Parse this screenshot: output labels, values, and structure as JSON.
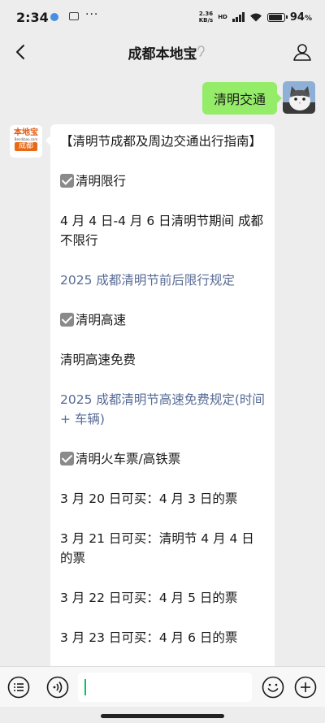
{
  "status": {
    "time": "2:34",
    "net_speed": "2.36\nKB/s",
    "hd": "HD",
    "battery": "94",
    "battery_unit": "%",
    "battery_level": 0.94
  },
  "header": {
    "title": "成都本地宝"
  },
  "chat": {
    "sent": {
      "text": "清明交通"
    },
    "sender_avatar": {
      "logo_top": "本地宝",
      "logo_url": "Bendibao.com",
      "logo_city": "成都"
    },
    "reply": [
      {
        "kind": "text",
        "text": "【清明节成都及周边交通出行指南】"
      },
      {
        "kind": "check",
        "text": "清明限行"
      },
      {
        "kind": "text",
        "text": "4 月 4 日-4 月 6 日清明节期间 成都不限行"
      },
      {
        "kind": "link",
        "text": "2025 成都清明节前后限行规定"
      },
      {
        "kind": "check",
        "text": "清明高速"
      },
      {
        "kind": "text",
        "text": "清明高速免费"
      },
      {
        "kind": "link",
        "text": "2025 成都清明节高速免费规定(时间 + 车辆)"
      },
      {
        "kind": "check",
        "text": "清明火车票/高铁票"
      },
      {
        "kind": "text",
        "text": "3 月 20 日可买：4 月 3 日的票"
      },
      {
        "kind": "text",
        "text": "3 月 21 日可买：清明节 4 月 4 日的票"
      },
      {
        "kind": "text",
        "text": "3 月 22 日可买：4 月 5 日的票"
      },
      {
        "kind": "text",
        "text": "3 月 23 日可买：4 月 6 日的票"
      }
    ]
  },
  "input": {
    "value": ""
  }
}
